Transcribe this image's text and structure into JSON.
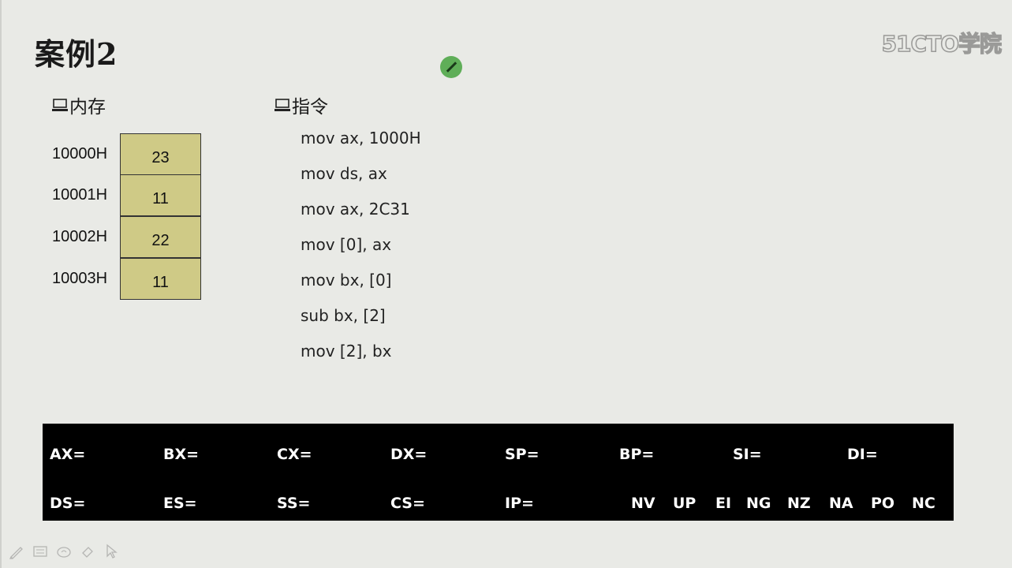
{
  "slide": {
    "title": "案例2",
    "watermark": "51CTO学院"
  },
  "memory": {
    "heading": "内存",
    "rows": [
      {
        "address": "10000H",
        "value": "23"
      },
      {
        "address": "10001H",
        "value": "11"
      },
      {
        "address": "10002H",
        "value": "22"
      },
      {
        "address": "10003H",
        "value": "11"
      }
    ],
    "cell_color": "#cfca86"
  },
  "instructions": {
    "heading": "指令",
    "lines": [
      "mov ax, 1000H",
      "mov ds, ax",
      "mov ax, 2C31",
      "mov [0], ax",
      "mov bx, [0]",
      "sub bx, [2]",
      "mov [2], bx"
    ]
  },
  "registers": {
    "row1": [
      "AX=",
      "BX=",
      "CX=",
      "DX=",
      "SP=",
      "BP=",
      "SI=",
      "DI="
    ],
    "row2": [
      "DS=",
      "ES=",
      "SS=",
      "CS=",
      "IP="
    ],
    "flags": [
      "NV",
      "UP",
      "EI",
      "NG",
      "NZ",
      "NA",
      "PO",
      "NC"
    ]
  },
  "toolbar": {
    "icons": [
      "pen-icon",
      "slides-icon",
      "ink-icon",
      "eraser-icon",
      "pointer-icon"
    ]
  }
}
